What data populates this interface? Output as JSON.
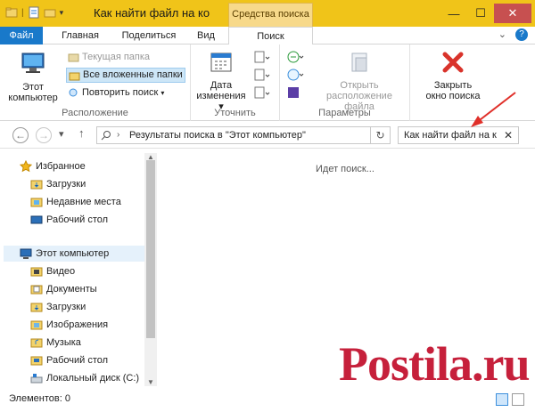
{
  "window": {
    "title": "Как найти файл на ко",
    "context_tab_header": "Средства поиска"
  },
  "tabs": {
    "file": "Файл",
    "home": "Главная",
    "share": "Поделиться",
    "view": "Вид",
    "search": "Поиск"
  },
  "ribbon": {
    "location": {
      "label": "Расположение",
      "this_pc": "Этот\nкомпьютер",
      "current_folder": "Текущая папка",
      "all_subfolders": "Все вложенные папки",
      "search_again": "Повторить поиск"
    },
    "refine": {
      "label": "Уточнить",
      "date_modified": "Дата\nизменения"
    },
    "options": {
      "label": "Параметры",
      "open_location": "Открыть\nрасположение файла"
    },
    "close": {
      "close_search": "Закрыть\nокно поиска"
    }
  },
  "address": {
    "text": "Результаты поиска в \"Этот компьютер\"",
    "search_value": "Как найти файл на к"
  },
  "navpane": {
    "favorites": "Избранное",
    "fav_items": [
      "Загрузки",
      "Недавние места",
      "Рабочий стол"
    ],
    "this_pc": "Этот компьютер",
    "pc_items": [
      "Видео",
      "Документы",
      "Загрузки",
      "Изображения",
      "Музыка",
      "Рабочий стол",
      "Локальный диск (C:)"
    ]
  },
  "content": {
    "message": "Идет поиск..."
  },
  "status": {
    "items": "Элементов: 0"
  },
  "watermark": "Postila.ru",
  "colors": {
    "title_bar": "#f0c419",
    "file_tab": "#1979ca",
    "arrow": "#e0302a",
    "watermark": "#c6203b"
  }
}
